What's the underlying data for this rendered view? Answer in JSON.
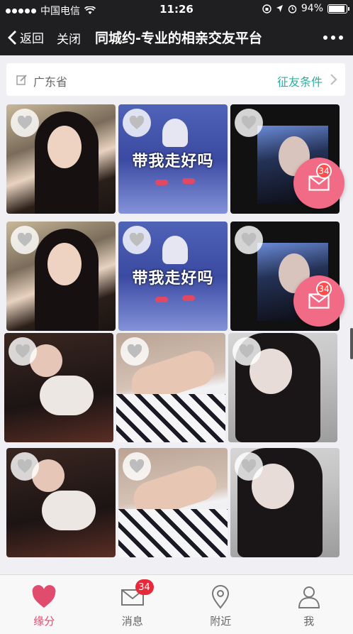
{
  "status_bar": {
    "carrier": "中国电信",
    "time": "11:26",
    "battery_percent": "94%",
    "battery_level": 0.94
  },
  "nav": {
    "back_label": "返回",
    "close_label": "关闭",
    "title": "同城约-专业的相亲交友平台"
  },
  "filter": {
    "province": "广东省",
    "condition_label": "征友条件"
  },
  "grid": {
    "tiles": [
      {
        "photo": "woman-selfie"
      },
      {
        "photo": "walking-text",
        "caption": "带我走好吗"
      },
      {
        "photo": "screen-selfie"
      },
      {
        "photo": "woman-selfie"
      },
      {
        "photo": "walking-text",
        "caption": "带我走好吗"
      },
      {
        "photo": "screen-selfie"
      },
      {
        "photo": "jacket-selfie"
      },
      {
        "photo": "stars-shirt"
      },
      {
        "photo": "girl-selfie"
      },
      {
        "photo": "jacket-selfie"
      },
      {
        "photo": "stars-shirt"
      },
      {
        "photo": "girl-selfie"
      }
    ],
    "mail_badge_count": "34"
  },
  "tabbar": {
    "items": [
      {
        "label": "缘分",
        "icon": "heart-icon",
        "active": true
      },
      {
        "label": "消息",
        "icon": "mail-icon",
        "badge": "34"
      },
      {
        "label": "附近",
        "icon": "location-pin-icon"
      },
      {
        "label": "我",
        "icon": "user-icon"
      }
    ]
  },
  "colors": {
    "accent_pink": "#e04b6e",
    "teal_link": "#2ab0a0",
    "badge_red": "#e8293a",
    "navbar_bg": "#1f1f22"
  }
}
